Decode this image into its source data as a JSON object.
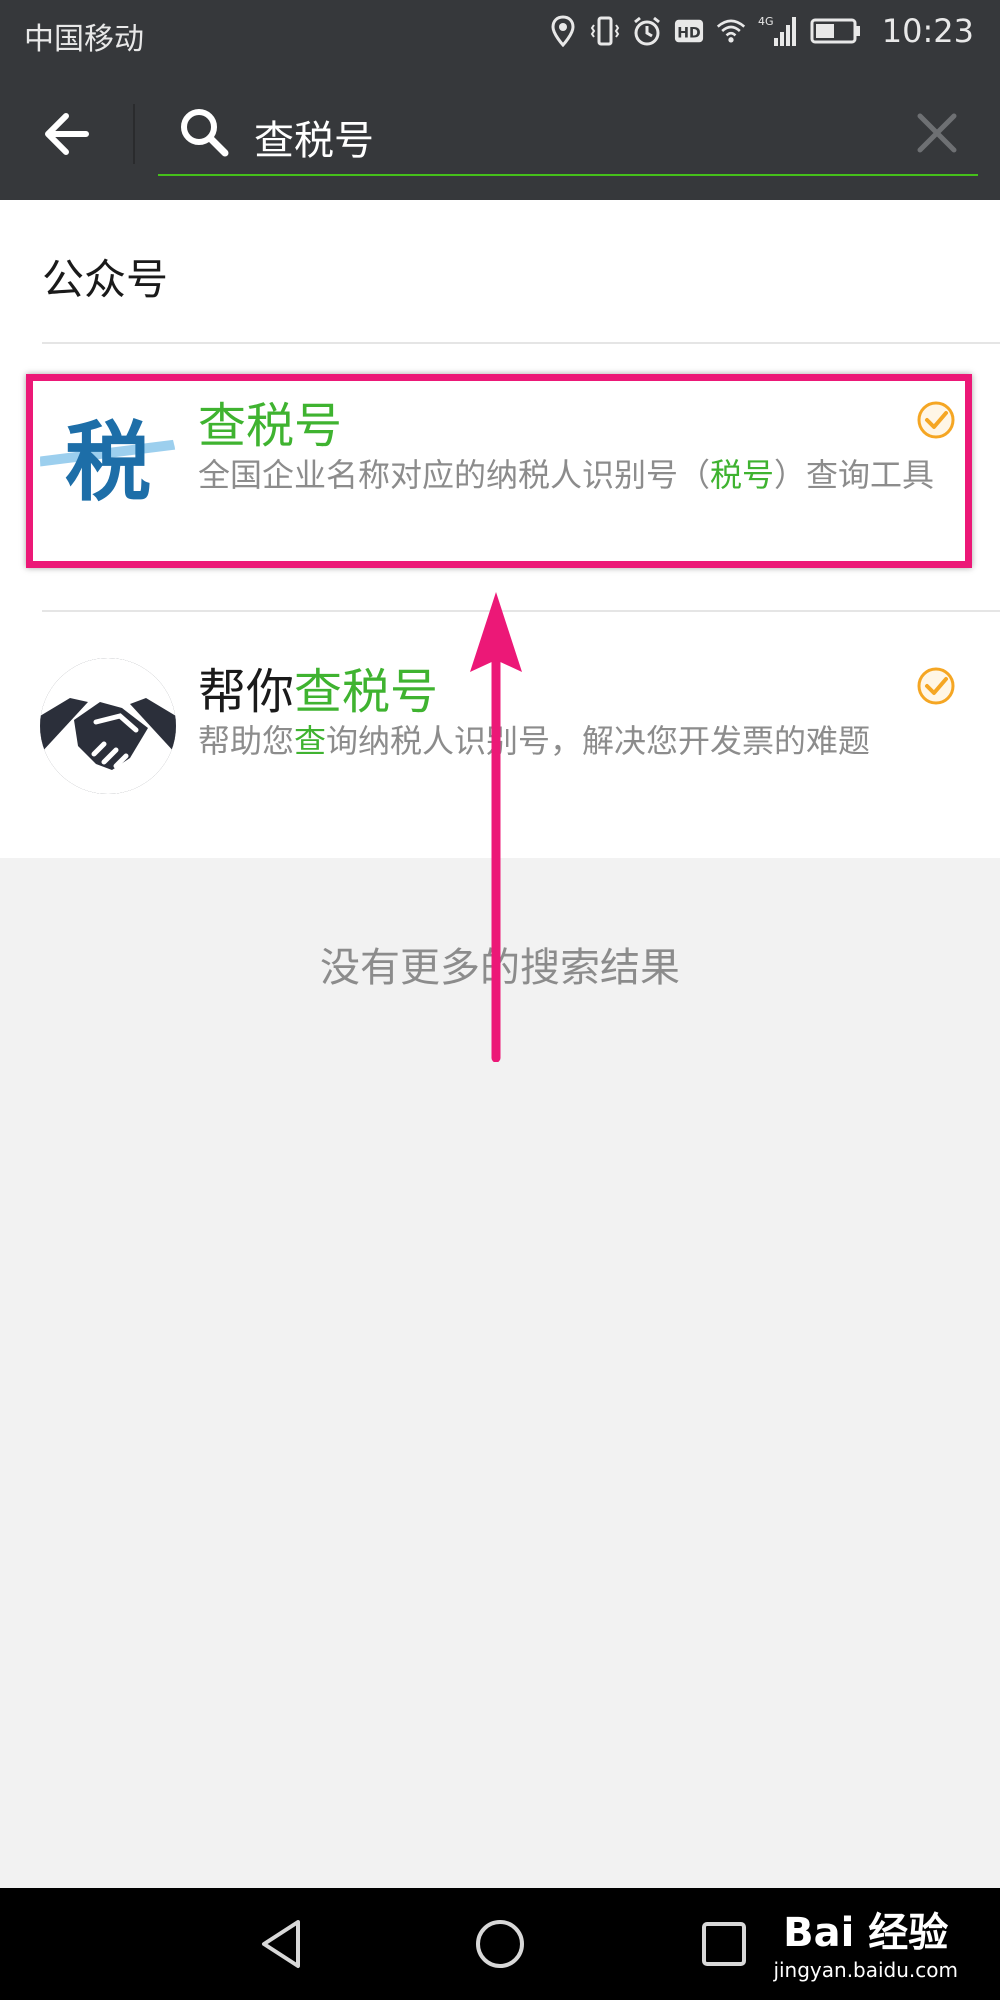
{
  "status_bar": {
    "carrier": "中国移动",
    "hd_label": "HD",
    "network_label": "4G",
    "time": "10:23"
  },
  "search": {
    "query": "查税号"
  },
  "results": {
    "section_title": "公众号",
    "items": [
      {
        "name_highlight": "查税号",
        "desc_a": "全国企业名称对应的纳税人识别号（",
        "desc_highlight": "税号",
        "desc_b": "）查询工具",
        "avatar_glyph": "税",
        "verified": true
      },
      {
        "name_prefix": "帮你",
        "name_highlight": "查税号",
        "desc_a": "帮助您",
        "desc_highlight": "查",
        "desc_b": "询纳税人识别号，解决您开发票的难题",
        "avatar_icon": "handshake-icon",
        "verified": true
      }
    ],
    "no_more": "没有更多的搜索结果"
  },
  "watermark": {
    "main": "Bai 经验",
    "sub": "jingyan.baidu.com"
  },
  "colors": {
    "header_bg": "#36383b",
    "accent_green": "#45c01a",
    "annotation_pink": "#ec1877",
    "verified_orange": "#f5a623"
  }
}
